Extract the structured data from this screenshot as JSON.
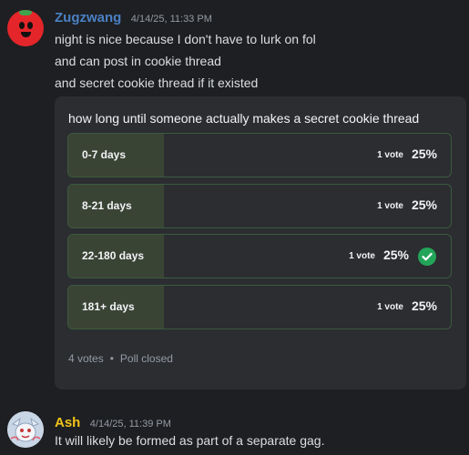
{
  "messages": [
    {
      "author": "Zugzwang",
      "author_color": "#4a80c4",
      "timestamp": "4/14/25, 11:33 PM",
      "lines": [
        "night is nice because I don't have to lurk on fol",
        "and can post in cookie thread",
        "and secret cookie thread if it existed"
      ]
    },
    {
      "author": "Ash",
      "author_color": "#f0c419",
      "timestamp": "4/14/25, 11:39 PM",
      "lines": [
        "It will likely be formed as part of a separate gag."
      ]
    }
  ],
  "poll": {
    "question": "how long until someone actually makes a secret cookie thread",
    "answers": [
      {
        "label": "0-7 days",
        "votes": "1 vote",
        "percent": "25%",
        "fill": 0.25,
        "selected": false
      },
      {
        "label": "8-21 days",
        "votes": "1 vote",
        "percent": "25%",
        "fill": 0.25,
        "selected": false
      },
      {
        "label": "22-180 days",
        "votes": "1 vote",
        "percent": "25%",
        "fill": 0.25,
        "selected": true
      },
      {
        "label": "181+ days",
        "votes": "1 vote",
        "percent": "25%",
        "fill": 0.25,
        "selected": false
      }
    ],
    "total_votes": "4 votes",
    "separator": "•",
    "status": "Poll closed"
  },
  "icons": {
    "zugzwang_avatar": "tomato-avatar-icon",
    "ash_avatar": "ash-avatar-icon",
    "selected_answer": "check-circle-icon"
  },
  "colors": {
    "background": "#1e1f22",
    "poll_background": "#2b2d31",
    "answer_border": "#3b5a3e",
    "answer_fill": "#3a4435",
    "check": "#23a559"
  }
}
